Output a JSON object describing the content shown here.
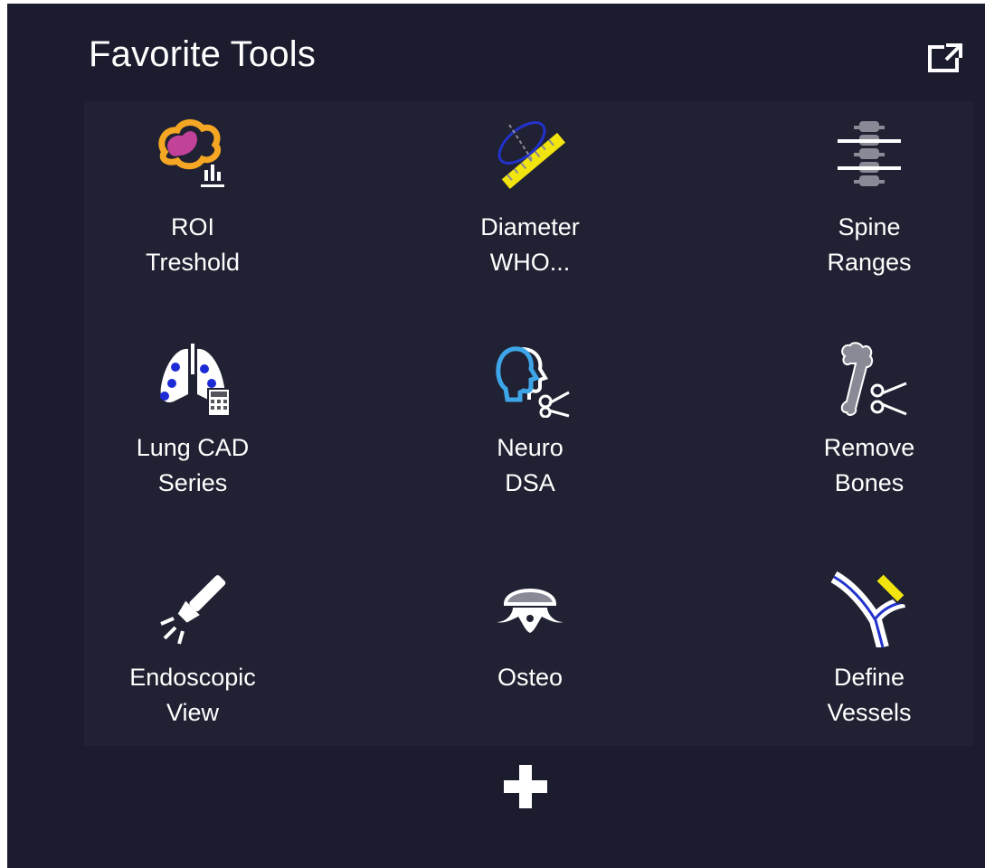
{
  "panel": {
    "title": "Favorite Tools",
    "popout_icon": "external-window-icon",
    "add_icon": "plus-icon"
  },
  "tools": [
    {
      "line1": "ROI",
      "line2": "Treshold",
      "icon": "roi-threshold-icon"
    },
    {
      "line1": "Diameter",
      "line2": "WHO...",
      "icon": "diameter-ruler-icon"
    },
    {
      "line1": "Spine",
      "line2": "Ranges",
      "icon": "spine-ranges-icon"
    },
    {
      "line1": "Lung CAD",
      "line2": "Series",
      "icon": "lung-cad-icon"
    },
    {
      "line1": "Neuro",
      "line2": "DSA",
      "icon": "neuro-dsa-icon"
    },
    {
      "line1": "Remove",
      "line2": "Bones",
      "icon": "remove-bones-icon"
    },
    {
      "line1": "Endoscopic",
      "line2": "View",
      "icon": "flashlight-icon"
    },
    {
      "line1": "Osteo",
      "line2": "",
      "icon": "osteo-vertebra-icon"
    },
    {
      "line1": "Define",
      "line2": "Vessels",
      "icon": "define-vessels-icon"
    }
  ],
  "colors": {
    "background": "#1b1c2d",
    "grid_background": "#202132",
    "text": "#ffffff",
    "roi_orange": "#f5a623",
    "roi_magenta": "#c2429a",
    "ruler_yellow": "#f2e40f",
    "outline_blue": "#2233cc",
    "dot_blue": "#1d2bd6",
    "neuro_blue": "#3ea6e8",
    "gray": "#8a8a96"
  }
}
